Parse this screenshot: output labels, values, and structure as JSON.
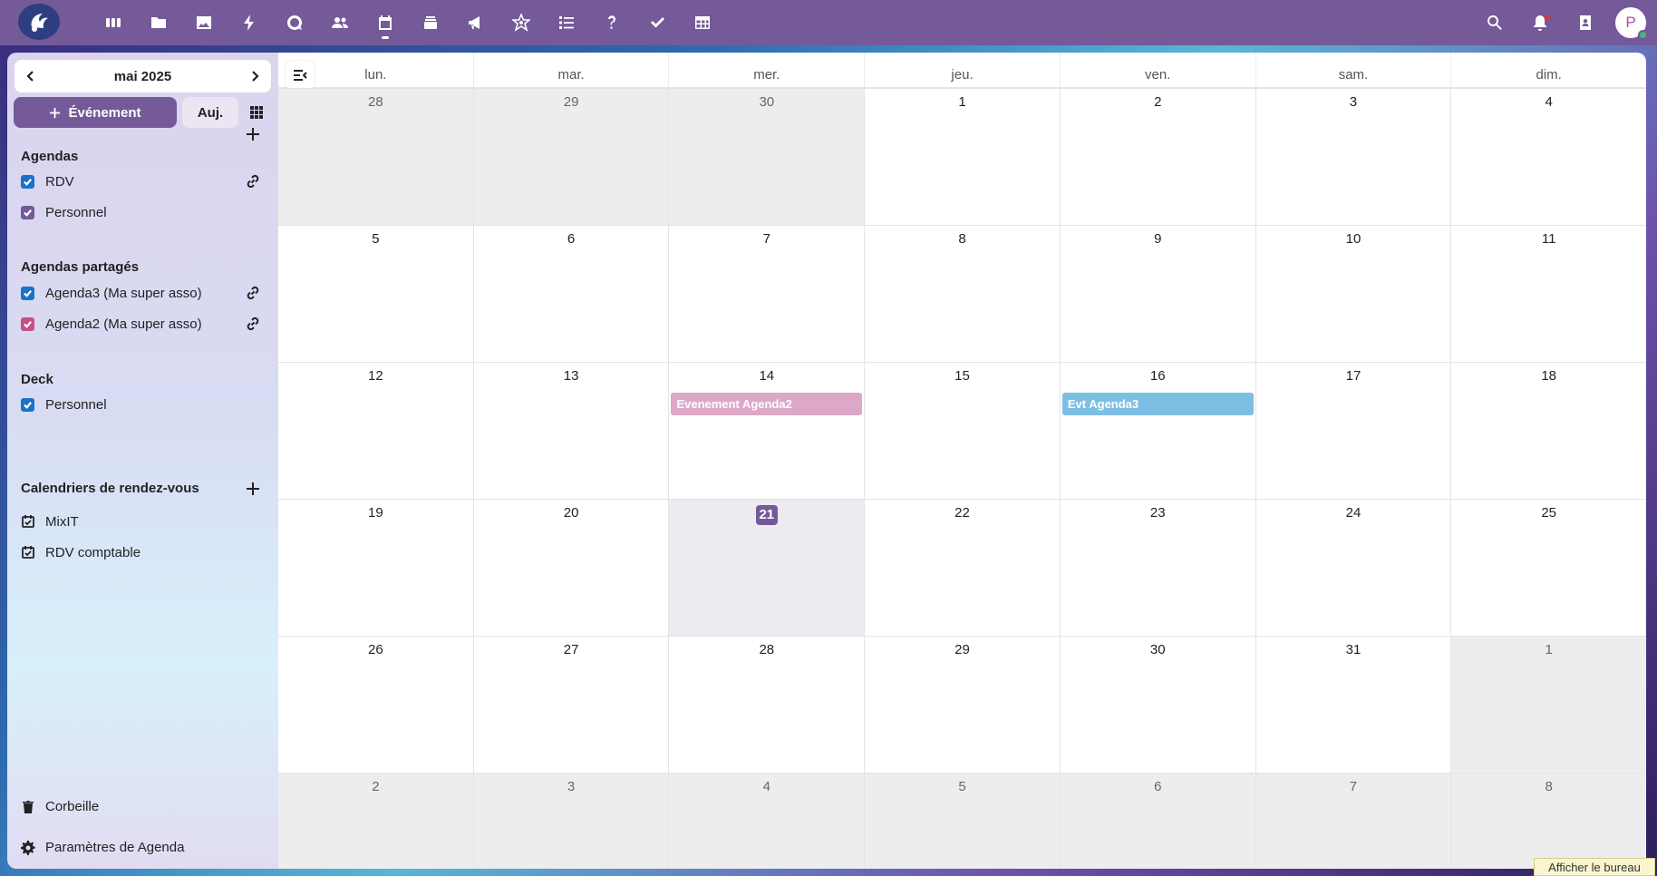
{
  "topbar": {
    "apps": [
      "dashboard-icon",
      "files-icon",
      "photos-icon",
      "activity-icon",
      "talk-icon",
      "contacts-icon",
      "calendar-icon",
      "deck-icon",
      "announcements-icon",
      "circles-icon",
      "tasks-icon",
      "help-icon",
      "checkmark-icon",
      "tables-icon"
    ],
    "active_app": "calendar-icon",
    "avatar_letter": "P"
  },
  "sidebar": {
    "month": "mai 2025",
    "new_event_label": "Événement",
    "today_label": "Auj.",
    "agendas_title": "Agendas",
    "agendas": [
      {
        "label": "RDV",
        "color": "#1a73c4",
        "shared_link": true
      },
      {
        "label": "Personnel",
        "color": "#745a98",
        "shared_link": false
      }
    ],
    "shared_title": "Agendas partagés",
    "shared": [
      {
        "label": "Agenda3 (Ma super asso)",
        "color": "#1a73c4",
        "shared_link": true
      },
      {
        "label": "Agenda2 (Ma super asso)",
        "color": "#c94f87",
        "shared_link": true
      }
    ],
    "deck_title": "Deck",
    "deck": [
      {
        "label": "Personnel",
        "color": "#1a73c4"
      }
    ],
    "appointments_title": "Calendriers de rendez-vous",
    "appointments": [
      {
        "label": "MixIT"
      },
      {
        "label": "RDV comptable"
      }
    ],
    "trash_label": "Corbeille",
    "settings_label": "Paramètres de Agenda"
  },
  "calendar": {
    "day_headers": [
      "lun.",
      "mar.",
      "mer.",
      "jeu.",
      "ven.",
      "sam.",
      "dim."
    ],
    "weeks": [
      [
        {
          "n": "28",
          "other": true
        },
        {
          "n": "29",
          "other": true
        },
        {
          "n": "30",
          "other": true
        },
        {
          "n": "1"
        },
        {
          "n": "2"
        },
        {
          "n": "3"
        },
        {
          "n": "4"
        }
      ],
      [
        {
          "n": "5"
        },
        {
          "n": "6"
        },
        {
          "n": "7"
        },
        {
          "n": "8"
        },
        {
          "n": "9"
        },
        {
          "n": "10"
        },
        {
          "n": "11"
        }
      ],
      [
        {
          "n": "12"
        },
        {
          "n": "13"
        },
        {
          "n": "14",
          "event": {
            "label": "Evenement Agenda2",
            "color": "#dda8c8"
          }
        },
        {
          "n": "15"
        },
        {
          "n": "16",
          "event": {
            "label": "Evt Agenda3",
            "color": "#7dbfe4"
          }
        },
        {
          "n": "17"
        },
        {
          "n": "18"
        }
      ],
      [
        {
          "n": "19"
        },
        {
          "n": "20"
        },
        {
          "n": "21",
          "today": true
        },
        {
          "n": "22"
        },
        {
          "n": "23"
        },
        {
          "n": "24"
        },
        {
          "n": "25"
        }
      ],
      [
        {
          "n": "26"
        },
        {
          "n": "27"
        },
        {
          "n": "28"
        },
        {
          "n": "29"
        },
        {
          "n": "30"
        },
        {
          "n": "31"
        },
        {
          "n": "1",
          "other": true
        }
      ],
      [
        {
          "n": "2",
          "other": true
        },
        {
          "n": "3",
          "other": true
        },
        {
          "n": "4",
          "other": true
        },
        {
          "n": "5",
          "other": true
        },
        {
          "n": "6",
          "other": true
        },
        {
          "n": "7",
          "other": true
        },
        {
          "n": "8",
          "other": true
        }
      ]
    ]
  },
  "desktop_button": "Afficher le bureau"
}
